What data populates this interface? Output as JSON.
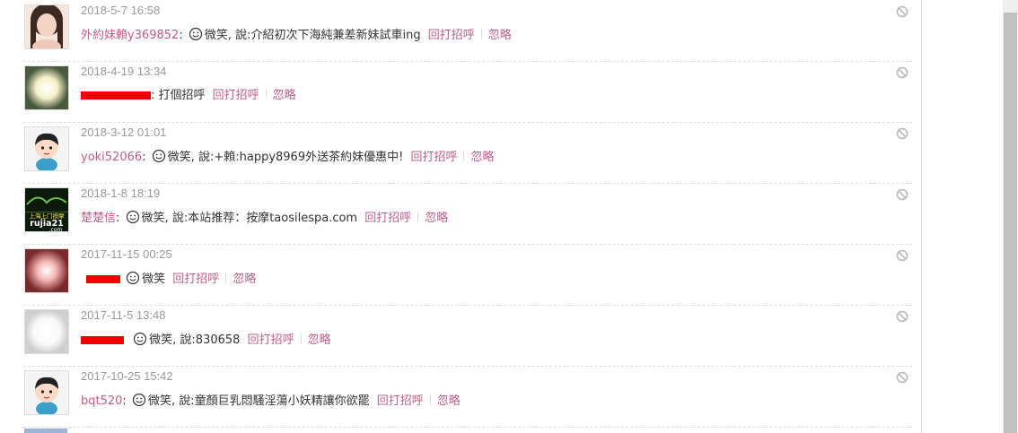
{
  "entries": [
    {
      "time": "2018-5-7 16:58",
      "user": "外約妹賴y369852",
      "user_redacted": false,
      "sep": ":",
      "verb": "微笑,",
      "text": " 說:介紹初次下海純兼差新妹試車ing",
      "avatar": "photo-girl"
    },
    {
      "time": "2018-4-19 13:34",
      "user": "",
      "user_redacted": true,
      "sep": ": 打個招呼",
      "verb": "",
      "text": "",
      "avatar": "glow-yellow"
    },
    {
      "time": "2018-3-12 01:01",
      "user": "yoki52066",
      "user_redacted": false,
      "sep": ":",
      "verb": "微笑,",
      "text": " 說:+賴:happy8969外送茶約妹優惠中!",
      "avatar": "cartoon-boy"
    },
    {
      "time": "2018-1-8 18:19",
      "user": "楚楚信",
      "user_redacted": false,
      "sep": ":",
      "verb": "微笑,",
      "text": " 說:本站推荐：按摩taosilespa.com",
      "avatar": "logo-rujia21"
    },
    {
      "time": "2017-11-15 00:25",
      "user": "",
      "user_redacted": true,
      "sep": "",
      "verb": "微笑",
      "text": "",
      "avatar": "glow-red"
    },
    {
      "time": "2017-11-5 13:48",
      "user": "",
      "user_redacted": true,
      "sep": "",
      "verb": "微笑,",
      "text": " 說:830658",
      "avatar": "glow-white"
    },
    {
      "time": "2017-10-25 15:42",
      "user": "bqt520",
      "user_redacted": false,
      "sep": ":",
      "verb": "微笑,",
      "text": " 說:童顏巨乳悶騷淫蕩小妖精讓你欲罷",
      "avatar": "cartoon-boy"
    }
  ],
  "actions": {
    "reply": "回打招呼",
    "ignore": "忽略"
  },
  "icons": {
    "block": "block-icon",
    "smile": "smile-icon"
  },
  "colors": {
    "link": "#c05c8a",
    "time": "#999999",
    "redaction": "#f20000"
  },
  "logo_text": {
    "line1": "上海上门按摩",
    "line2": "rujia21",
    ".com": ".com"
  }
}
